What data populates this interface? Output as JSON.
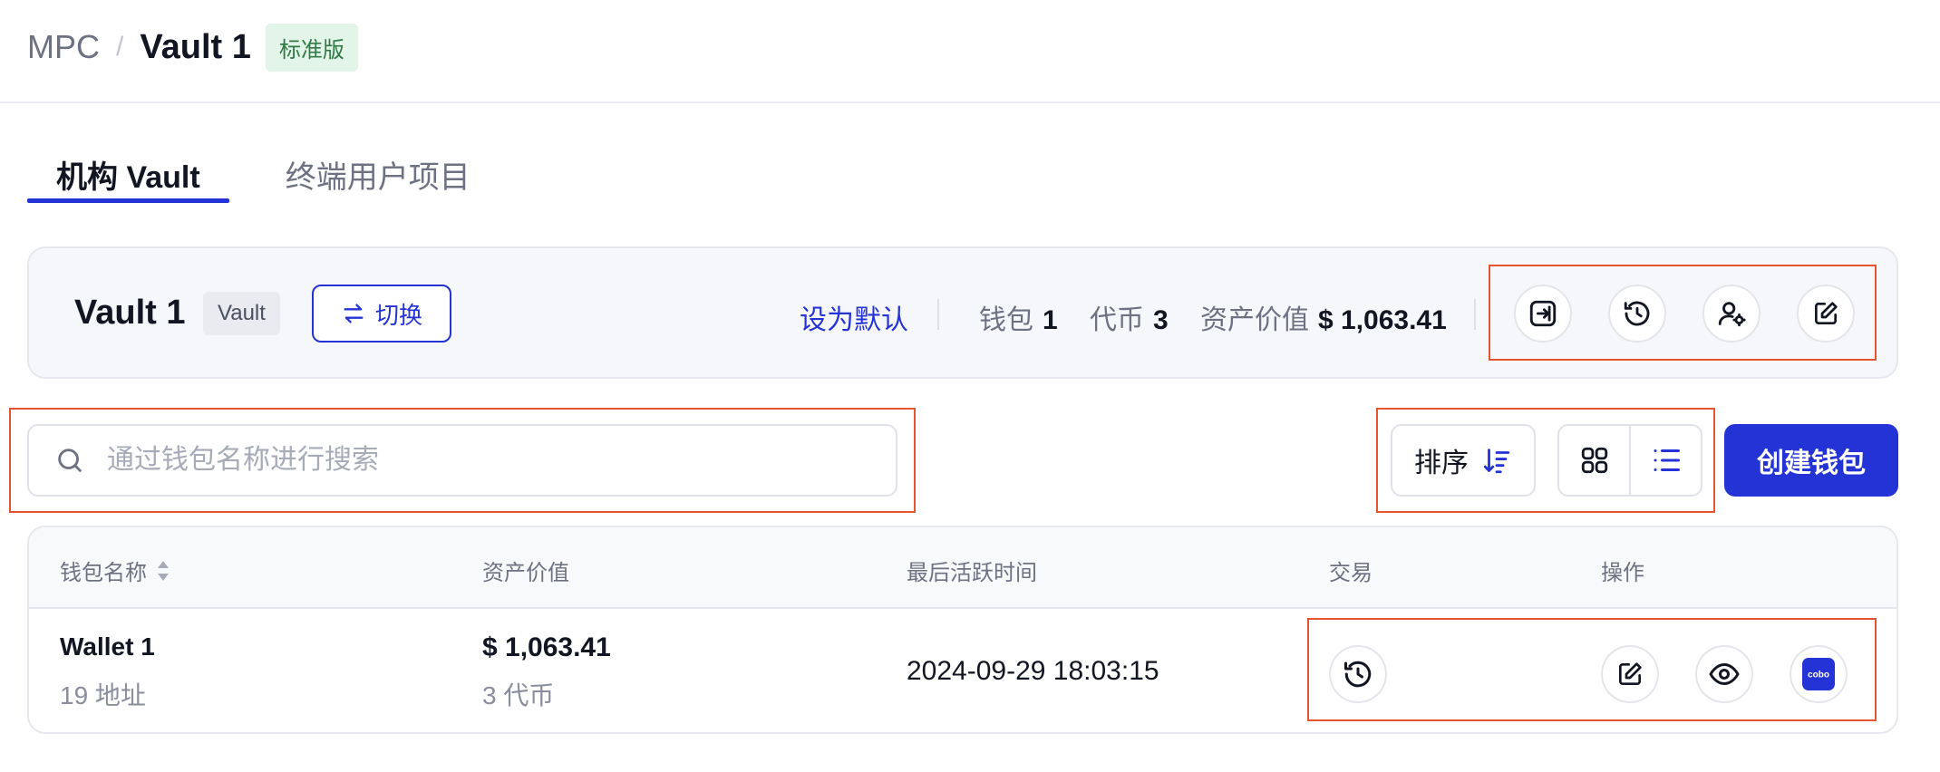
{
  "breadcrumb": {
    "root": "MPC",
    "separator": "/",
    "current": "Vault 1",
    "badge": "标准版"
  },
  "tabs": [
    {
      "label": "机构 Vault",
      "active": true
    },
    {
      "label": "终端用户项目",
      "active": false
    }
  ],
  "vault": {
    "name": "Vault 1",
    "tag": "Vault",
    "switch_label": "切换",
    "set_default": "设为默认",
    "stats": [
      {
        "label": "钱包",
        "value": "1"
      },
      {
        "label": "代币",
        "value": "3"
      },
      {
        "label": "资产价值",
        "value": "$ 1,063.41"
      }
    ],
    "actions": [
      "login-icon",
      "history-icon",
      "user-settings-icon",
      "edit-icon"
    ]
  },
  "search": {
    "placeholder": "通过钱包名称进行搜索",
    "value": ""
  },
  "sort_label": "排序",
  "view_modes": [
    "grid-view-icon",
    "list-view-icon"
  ],
  "create_label": "创建钱包",
  "table": {
    "headers": [
      "钱包名称",
      "资产价值",
      "最后活跃时间",
      "交易",
      "操作"
    ],
    "rows": [
      {
        "name": "Wallet 1",
        "addresses": "19 地址",
        "value": "$ 1,063.41",
        "tokens": "3 代币",
        "last_active": "2024-09-29 18:03:15",
        "cobo_logo": "cobo"
      }
    ]
  },
  "colors": {
    "accent": "#2433d6",
    "badge_green": "#e3f4e8",
    "highlight": "#e8542f"
  }
}
